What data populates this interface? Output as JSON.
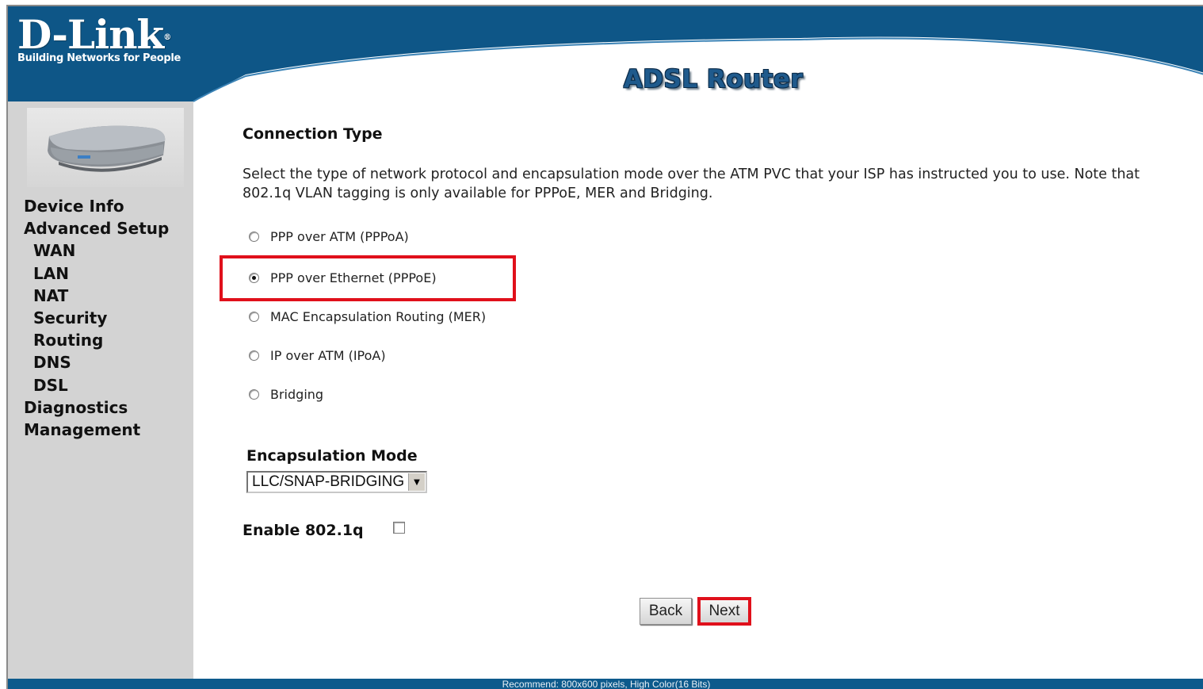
{
  "brand": {
    "logo": "D-Link",
    "tagline": "Building Networks for People"
  },
  "header": {
    "title": "ADSL Router"
  },
  "sidebar": {
    "items": [
      {
        "label": "Device Info"
      },
      {
        "label": "Advanced Setup"
      },
      {
        "label": "WAN"
      },
      {
        "label": "LAN"
      },
      {
        "label": "NAT"
      },
      {
        "label": "Security"
      },
      {
        "label": "Routing"
      },
      {
        "label": "DNS"
      },
      {
        "label": "DSL"
      },
      {
        "label": "Diagnostics"
      },
      {
        "label": "Management"
      }
    ]
  },
  "main": {
    "title": "Connection Type",
    "description": "Select the type of network protocol and encapsulation mode over the ATM PVC that your ISP has instructed you to use. Note that 802.1q VLAN tagging is only available for PPPoE, MER and Bridging.",
    "options": [
      {
        "label": "PPP over ATM (PPPoA)",
        "selected": false
      },
      {
        "label": "PPP over Ethernet (PPPoE)",
        "selected": true
      },
      {
        "label": "MAC Encapsulation Routing (MER)",
        "selected": false
      },
      {
        "label": "IP over ATM (IPoA)",
        "selected": false
      },
      {
        "label": "Bridging",
        "selected": false
      }
    ],
    "encapsulation": {
      "label": "Encapsulation Mode",
      "selected": "LLC/SNAP-BRIDGING"
    },
    "vlan": {
      "label": "Enable 802.1q",
      "checked": false
    },
    "buttons": {
      "back": "Back",
      "next": "Next"
    }
  },
  "footer": {
    "text": "Recommend: 800x600 pixels, High Color(16 Bits)"
  },
  "colors": {
    "header_blue": "#0e5687",
    "sidebar_gray": "#d3d3d3",
    "highlight_red": "#e0101b",
    "footer_blue": "#0d5a8c"
  },
  "icons": {
    "router": "router-device-image",
    "select_arrow": "chevron-down-icon"
  }
}
